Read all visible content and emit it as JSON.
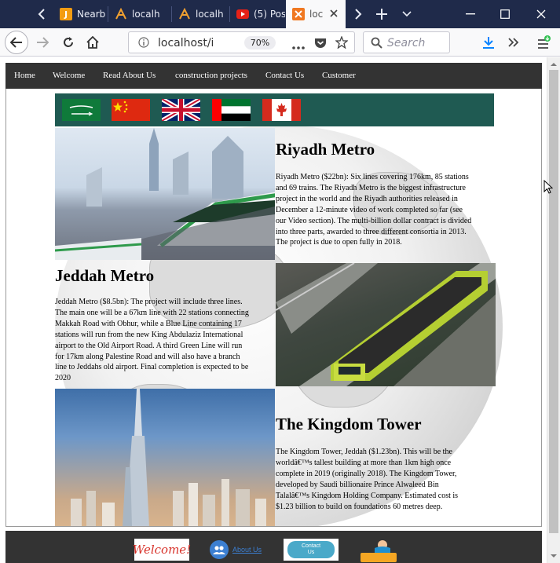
{
  "tabs": [
    {
      "label": "Nearby",
      "icon": "j-icon"
    },
    {
      "label": "localh",
      "icon": "xampp-icon"
    },
    {
      "label": "localh",
      "icon": "xampp-icon"
    },
    {
      "label": "(5) Pos",
      "icon": "youtube-icon"
    },
    {
      "label": "loc",
      "icon": "xampp-icon",
      "active": true
    }
  ],
  "address": {
    "url": "localhost/im",
    "zoom": "70%"
  },
  "search": {
    "placeholder": "Search"
  },
  "nav": {
    "items": [
      "Home",
      "Welcome",
      "Read About Us",
      "construction projects",
      "Contact Us",
      "Customer"
    ]
  },
  "flags": [
    "saudi-arabia-flag",
    "china-flag",
    "uk-flag",
    "uae-flag",
    "canada-flag"
  ],
  "sections": {
    "riyadh": {
      "title": "Riyadh Metro",
      "lines": [
        "Riyadh Metro ($22bn): Six lines covering 176km, 85 stations",
        "and 69 trains. The Riyadh Metro is the biggest infrastructure",
        "project in the world and the Riyadh authorities released in",
        "December a 12-minute video of work completed so far (see",
        "our Video section). The multi-billion dollar contract is divided",
        "into three parts, awarded to three different consortia in 2013.",
        "The project is due to open fully in 2018."
      ]
    },
    "jeddah": {
      "title": "Jeddah Metro",
      "lines": [
        "Jeddah Metro ($8.5bn): The project will include three lines.",
        "The main one will be a 67km line with 22 stations connecting",
        "Makkah Road with Obhur, while a Blue Line containing 17",
        "stations will run from the new King Abdulaziz International",
        "airport to the Old Airport Road. A third Green Line will run",
        "for 17km along Palestine Road and will also have a branch",
        "line to Jeddahs old airport. Final completion is expected to be",
        "2020"
      ]
    },
    "tower": {
      "title": "The Kingdom Tower",
      "lines": [
        "The Kingdom Tower, Jeddah ($1.23bn). This will be the",
        "worldâ€™s tallest building at more than 1km high once",
        "complete in 2019 (originally 2018). The Kingdom Tower,",
        "developed by Saudi billionaire Prince Alwaleed Bin",
        "Talalâ€™s Kingdom Holding Company. Estimated cost is",
        "$1.23 billion to build on foundations 60 metres deep."
      ]
    }
  },
  "footer": {
    "welcome": "Welcome!",
    "about": "About Us",
    "contact_line1": "Contact",
    "contact_line2": "Us"
  }
}
